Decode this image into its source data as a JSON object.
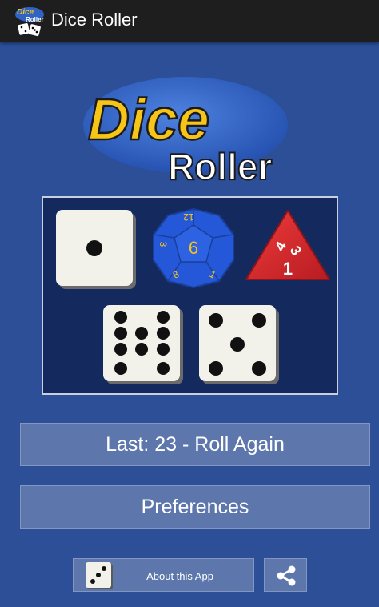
{
  "app_bar": {
    "title": "Dice Roller",
    "icon": "app-dice-logo-icon",
    "icon_text_top": "Dice",
    "icon_text_bottom": "Roller"
  },
  "logo": {
    "word1": "Dice",
    "word2": "Roller"
  },
  "dice_panel": {
    "d6_a": {
      "value": 1
    },
    "d12": {
      "value": "6",
      "side_labels": [
        "12",
        "3",
        "8",
        "1"
      ]
    },
    "d4": {
      "labels": [
        "4",
        "3",
        "1"
      ]
    },
    "d9_pips": {
      "value": 9
    },
    "d6_b": {
      "value": 5
    }
  },
  "buttons": {
    "roll_label": "Last:  23 - Roll Again",
    "preferences_label": "Preferences",
    "about_label": "About this App"
  },
  "icons": {
    "share": "share-icon",
    "about_die": "die-three-icon"
  },
  "colors": {
    "background": "#2c4f97",
    "app_bar": "#1e1e1e",
    "button": "#5d77ad",
    "logo_yellow": "#f7c518",
    "logo_oval": "#2f63c4",
    "d4_red": "#d9262b",
    "d12_blue": "#2458d8"
  }
}
